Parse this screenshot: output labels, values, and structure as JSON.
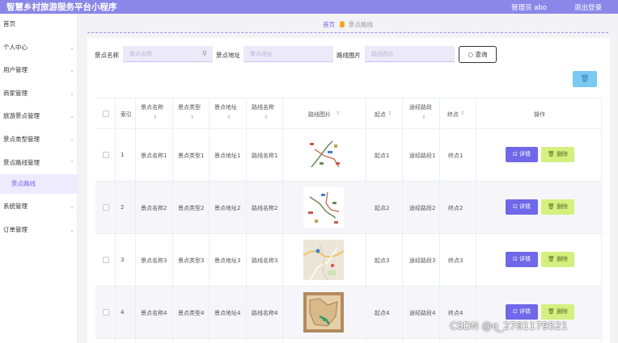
{
  "header": {
    "app_title": "智慧乡村旅游服务平台小程序",
    "user_info": "管理员 abo",
    "logout": "退出登录"
  },
  "sidebar": {
    "items": [
      {
        "label": "首页",
        "arrow": ""
      },
      {
        "label": "个人中心",
        "arrow": "⌄"
      },
      {
        "label": "用户管理",
        "arrow": "⌄"
      },
      {
        "label": "商家管理",
        "arrow": "⌄"
      },
      {
        "label": "旅游景点管理",
        "arrow": "⌄"
      },
      {
        "label": "景点类型管理",
        "arrow": "⌄"
      },
      {
        "label": "景点路线管理",
        "arrow": "⌃"
      },
      {
        "label": "系统管理",
        "arrow": "⌄"
      },
      {
        "label": "订单管理",
        "arrow": "⌄"
      }
    ],
    "active_sub": "景点路线"
  },
  "breadcrumb": {
    "home": "首页",
    "current": "景点路线"
  },
  "search": {
    "name_label": "景点名称",
    "name_placeholder": "景点名称",
    "address_label": "景点地址",
    "address_placeholder": "景点地址",
    "image_label": "路线图片",
    "image_placeholder": "路线图片",
    "query_button": "查询"
  },
  "toolbar": {
    "delete_icon": "trash-icon"
  },
  "table": {
    "headers": {
      "index": "索引",
      "name": "景点名称",
      "type": "景点类型",
      "address": "景点地址",
      "route": "路线名称",
      "image": "路线图片",
      "start": "起点",
      "via": "途经路段",
      "end": "终点",
      "ops": "操作"
    },
    "sort_mark": "⇕",
    "rows": [
      {
        "index": "1",
        "name": "景点名称1",
        "type": "景点类型1",
        "address": "景点地址1",
        "route": "路线名称1",
        "start": "起点1",
        "via": "途经路段1",
        "end": "终点1",
        "detail": "详情",
        "delete": "删除"
      },
      {
        "index": "2",
        "name": "景点名称2",
        "type": "景点类型2",
        "address": "景点地址2",
        "route": "路线名称2",
        "start": "起点2",
        "via": "途经路段2",
        "end": "终点2",
        "detail": "详情",
        "delete": "删除"
      },
      {
        "index": "3",
        "name": "景点名称3",
        "type": "景点类型3",
        "address": "景点地址3",
        "route": "路线名称3",
        "start": "起点3",
        "via": "途经路段3",
        "end": "终点3",
        "detail": "详情",
        "delete": "删除"
      },
      {
        "index": "4",
        "name": "景点名称4",
        "type": "景点类型4",
        "address": "景点地址4",
        "route": "路线名称4",
        "start": "起点4",
        "via": "途经路段4",
        "end": "终点4",
        "detail": "详情",
        "delete": "删除"
      }
    ]
  },
  "watermark": "CSDN @q_2781179521",
  "colors": {
    "accent": "#8b87e8",
    "primary_button": "#6f68e8",
    "delete_button": "#d4f07e",
    "top_delete": "#7ac9f3"
  }
}
